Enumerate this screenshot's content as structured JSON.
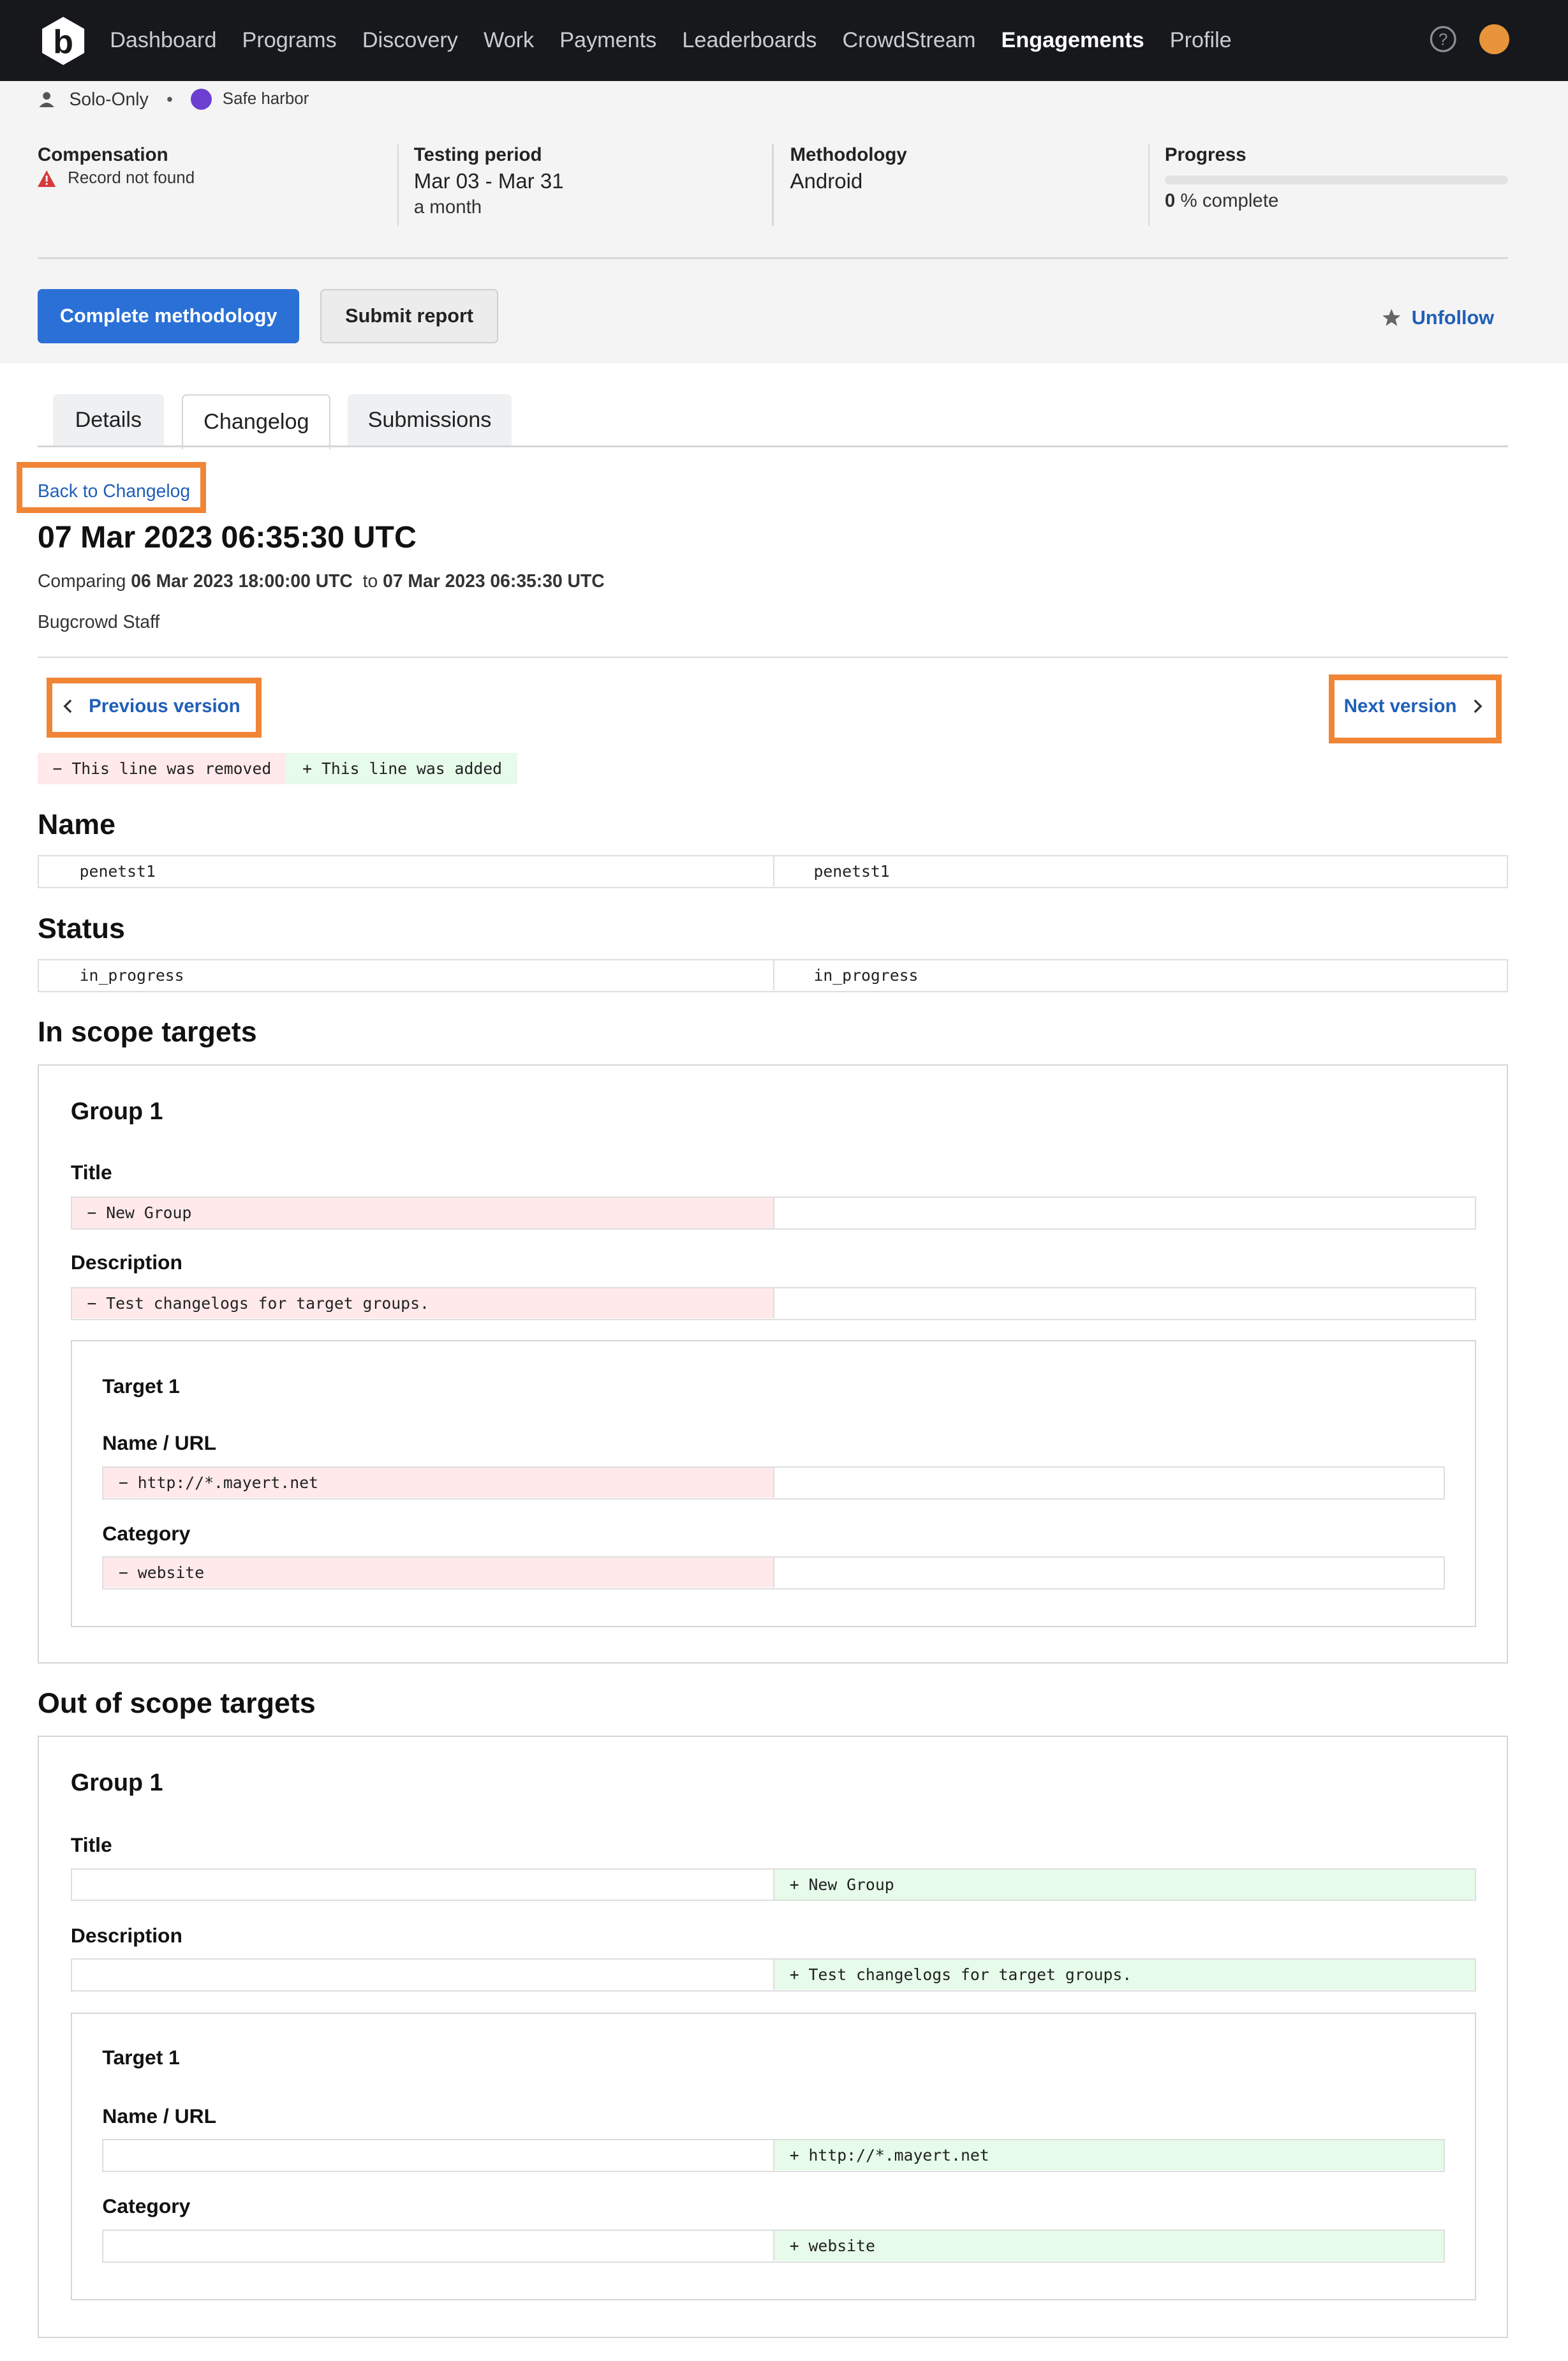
{
  "nav": {
    "items": [
      "Dashboard",
      "Programs",
      "Discovery",
      "Work",
      "Payments",
      "Leaderboards",
      "CrowdStream",
      "Engagements",
      "Profile"
    ],
    "active_index": 7,
    "logo_icon": "bugcrowd-logo-icon",
    "help_icon": "help-circle-icon",
    "avatar_color": "#e8943a"
  },
  "engagement": {
    "participation": "Solo-Only",
    "safe_harbor": "Safe harbor",
    "compensation_label": "Compensation",
    "compensation_value": "Record not found",
    "testing_period_label": "Testing period",
    "testing_period_value": "Mar 03 - Mar 31",
    "testing_period_sub": "a month",
    "methodology_label": "Methodology",
    "methodology_value": "Android",
    "progress_label": "Progress",
    "progress_percent": "0",
    "progress_suffix": "% complete",
    "progress_fraction": 0
  },
  "actions": {
    "complete_methodology": "Complete methodology",
    "submit_report": "Submit report",
    "unfollow": "Unfollow"
  },
  "tabs": [
    "Details",
    "Changelog",
    "Submissions"
  ],
  "active_tab": "Changelog",
  "changelog": {
    "back_link": "Back to Changelog",
    "title": "07 Mar 2023 06:35:30 UTC",
    "comparing_prefix": "Comparing",
    "from": "06 Mar 2023 18:00:00 UTC",
    "to_word": "to",
    "to": "07 Mar 2023 06:35:30 UTC",
    "author": "Bugcrowd Staff",
    "previous_version": "Previous version",
    "next_version": "Next version",
    "legend_removed": "−  This line was removed",
    "legend_added": "+  This line was added"
  },
  "sections": {
    "name": {
      "heading": "Name",
      "left": "penetst1",
      "right": "penetst1"
    },
    "status": {
      "heading": "Status",
      "left": "in_progress",
      "right": "in_progress"
    },
    "in_scope": {
      "heading": "In scope targets",
      "group_title": "Group 1",
      "title_label": "Title",
      "title_removed": "−  New Group",
      "description_label": "Description",
      "description_removed": "−  Test changelogs for target groups.",
      "target_title": "Target 1",
      "name_url_label": "Name / URL",
      "name_url_removed": "−  http://*.mayert.net",
      "category_label": "Category",
      "category_removed": "−  website"
    },
    "out_scope": {
      "heading": "Out of scope targets",
      "group_title": "Group 1",
      "title_label": "Title",
      "title_added": "+  New Group",
      "description_label": "Description",
      "description_added": "+  Test changelogs for target groups.",
      "target_title": "Target 1",
      "name_url_label": "Name / URL",
      "name_url_added": "+  http://*.mayert.net",
      "category_label": "Category",
      "category_added": "+  website"
    }
  },
  "colors": {
    "primary": "#2a70d6",
    "link": "#1f5fb8",
    "highlight": "#f08536",
    "removed_bg": "#ffe9ea",
    "added_bg": "#e6fbe9",
    "nav_bg": "#16181c"
  }
}
